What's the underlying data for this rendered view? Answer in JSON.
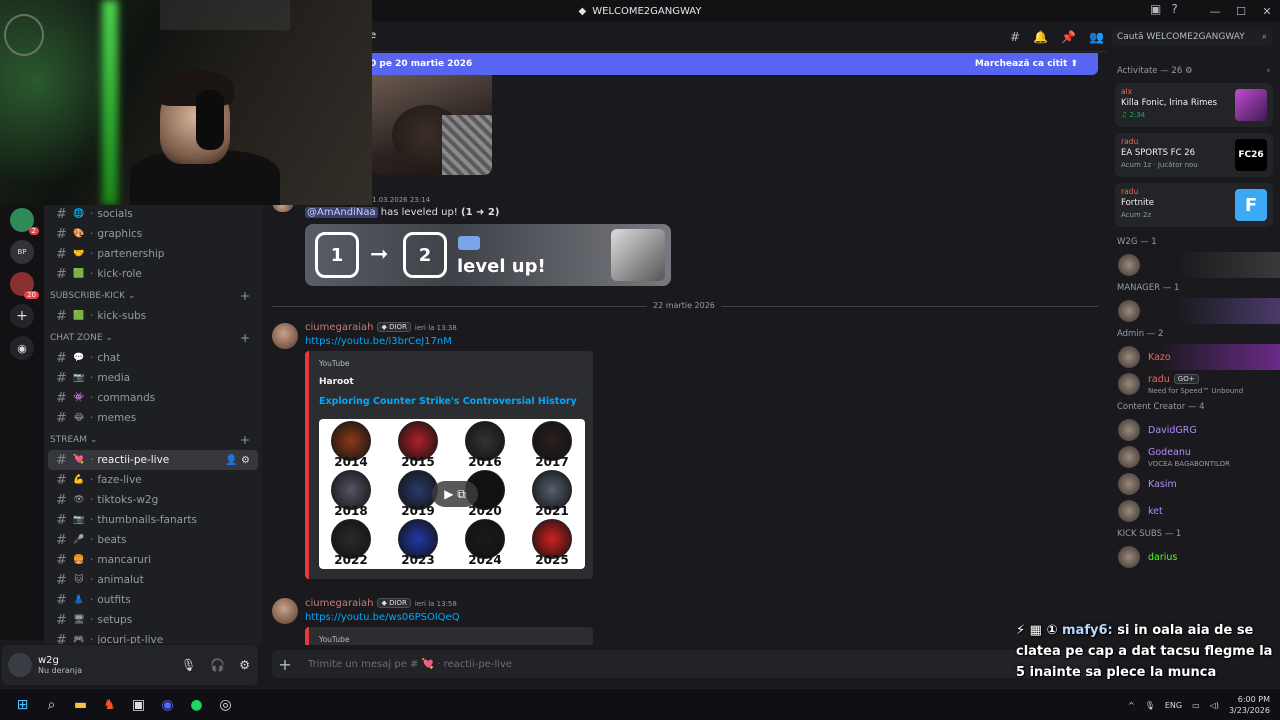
{
  "window": {
    "title": "WELCOME2GANGWAY",
    "search_placeholder": "Caută WELCOME2GANGWAY",
    "header_partial": "e"
  },
  "newbar": {
    "text": "0 pe 20 martie 2026",
    "action": "Marchează ca citit"
  },
  "guilds": [
    {
      "label": "",
      "badge": "2"
    },
    {
      "label": "BP",
      "badge": ""
    },
    {
      "label": "",
      "badge": "20"
    }
  ],
  "sidebar": {
    "top_channels": [
      {
        "emoji": "🌐",
        "name": "socials"
      },
      {
        "emoji": "🎨",
        "name": "graphics"
      },
      {
        "emoji": "🤝",
        "name": "partenership"
      },
      {
        "emoji": "🟩",
        "name": "kick-role"
      }
    ],
    "cat_subscribe": "SUBSCRIBE-KICK",
    "subscribe_channels": [
      {
        "emoji": "🟩",
        "name": "kick-subs"
      }
    ],
    "cat_chat": "CHAT ZONE",
    "chat_channels": [
      {
        "emoji": "💬",
        "name": "chat"
      },
      {
        "emoji": "📷",
        "name": "media"
      },
      {
        "emoji": "👾",
        "name": "commands"
      },
      {
        "emoji": "😂",
        "name": "memes"
      }
    ],
    "cat_stream": "STREAM",
    "stream_channels": [
      {
        "emoji": "💘",
        "name": "reactii-pe-live"
      },
      {
        "emoji": "💪",
        "name": "faze-live"
      },
      {
        "emoji": "👁",
        "name": "tiktoks-w2g"
      },
      {
        "emoji": "📷",
        "name": "thumbnails-fanarts"
      },
      {
        "emoji": "🎤",
        "name": "beats"
      },
      {
        "emoji": "🍔",
        "name": "mancaruri"
      },
      {
        "emoji": "🐱",
        "name": "animalut"
      },
      {
        "emoji": "👗",
        "name": "outfits"
      },
      {
        "emoji": "🖥",
        "name": "setups"
      },
      {
        "emoji": "🎮",
        "name": "jocuri-pt-live"
      }
    ]
  },
  "user": {
    "name": "w2g",
    "status": "Nu deranja"
  },
  "messages": {
    "stamp1": "1.03.2026 23:14",
    "level": {
      "mention": "@AmAndiNaa",
      "text": " has leveled up! ",
      "bold": "(1 ➜ 2)",
      "from": "1",
      "to": "2",
      "label": "level up!"
    },
    "date_divider": "22 martie 2026",
    "m1": {
      "author": "ciumegaraiah",
      "tag": "DIOR",
      "time": "ieri la 13:38",
      "link": "https://youtu.be/i3brCeJ17nM",
      "provider": "YouTube",
      "channel": "Haroot",
      "title": "Exploring Counter Strike's Controversial History",
      "years": [
        "2014",
        "2015",
        "2016",
        "2017",
        "2018",
        "2019",
        "2020",
        "2021",
        "2022",
        "2023",
        "2024",
        "2025"
      ]
    },
    "m2": {
      "author": "ciumegaraiah",
      "tag": "DIOR",
      "time": "ieri la 13:58",
      "link": "https://youtu.be/ws06PSOlQeQ",
      "provider": "YouTube"
    }
  },
  "composer": {
    "placeholder": "Trimite un mesaj pe #",
    "channel": "reactii-pe-live"
  },
  "members": {
    "activity_header": "Activitate — 26",
    "activities": [
      {
        "user": "alx",
        "title": "Killa Fonic, Irina Rimes",
        "sub": "2:34"
      },
      {
        "user": "radu",
        "title": "EA SPORTS FC 26",
        "sub": "Acum 1z",
        "sub2": "Jucător nou"
      },
      {
        "user": "radu",
        "title": "Fortnite",
        "sub": "Acum 2z"
      }
    ],
    "groups": [
      {
        "name": "W2G — 1",
        "members": [
          {
            "name": "",
            "status": "",
            "color": "#f2f3f5"
          }
        ]
      },
      {
        "name": "MANAGER — 1",
        "members": [
          {
            "name": "",
            "status": "",
            "color": "#e9675d"
          }
        ]
      },
      {
        "name": "Admin — 2",
        "members": [
          {
            "name": "Kazo",
            "status": "",
            "color": "#e9675d"
          },
          {
            "name": "radu",
            "status": "Need for Speed™ Unbound",
            "color": "#e9675d",
            "badge": "GO+"
          }
        ]
      },
      {
        "name": "Content Creator — 4",
        "members": [
          {
            "name": "DavidGRG",
            "status": "",
            "color": "#b18cff"
          },
          {
            "name": "Godeanu",
            "status": "VOCEA BAGABONTILOR",
            "color": "#b18cff"
          },
          {
            "name": "Kasim",
            "status": "",
            "color": "#b18cff"
          },
          {
            "name": "ket",
            "status": "",
            "color": "#b18cff"
          }
        ]
      },
      {
        "name": "KICK SUBS — 1",
        "members": [
          {
            "name": "darius",
            "status": "",
            "color": "#53fc18"
          }
        ]
      }
    ]
  },
  "overlay": {
    "user": "mafy6:",
    "text": "si in oala aia de se clatea pe cap a dat tacsu flegme la 5 inainte sa plece la munca"
  },
  "taskbar": {
    "lang": "ENG",
    "time": "6:00 PM",
    "date": "3/23/2026"
  }
}
